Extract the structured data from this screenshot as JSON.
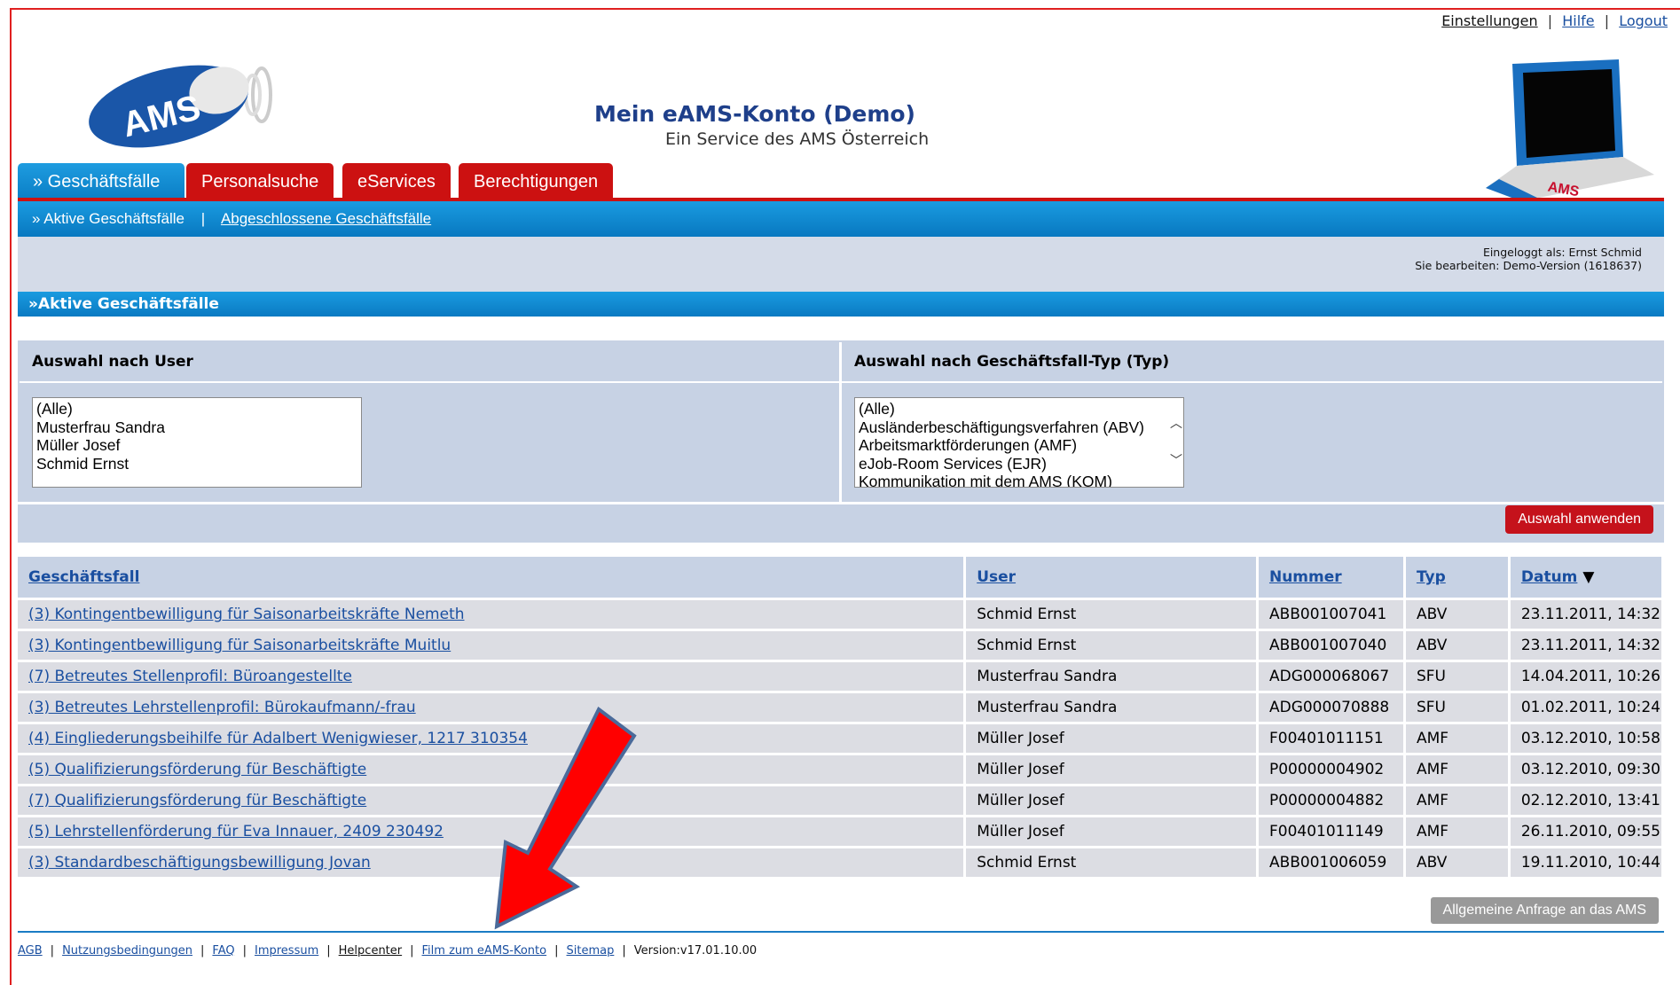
{
  "toplinks": {
    "settings": "Einstellungen",
    "help": "Hilfe",
    "logout": "Logout",
    "sep": "|"
  },
  "header": {
    "logo_text": "AMS",
    "title": "Mein eAMS-Konto (Demo)",
    "subtitle": "Ein Service des AMS Österreich",
    "laptop_label": "AMS"
  },
  "tabs": [
    {
      "label": "» Geschäftsfälle"
    },
    {
      "label": "Personalsuche"
    },
    {
      "label": "eServices"
    },
    {
      "label": "Berechtigungen"
    }
  ],
  "subnav": {
    "active": "» Aktive Geschäftsfälle",
    "sep": "|",
    "closed": "Abgeschlossene Geschäftsfälle"
  },
  "info": {
    "logged_in": "Eingeloggt als: Ernst Schmid",
    "editing": "Sie bearbeiten: Demo-Version (1618637)"
  },
  "section_title": "»Aktive Geschäftsfälle",
  "filter": {
    "user": {
      "heading": "Auswahl nach User",
      "options": [
        "(Alle)",
        "Musterfrau Sandra",
        "Müller Josef",
        "Schmid Ernst"
      ]
    },
    "type": {
      "heading": "Auswahl nach Geschäftsfall-Typ (Typ)",
      "options": [
        "(Alle)",
        "Ausländerbeschäftigungsverfahren (ABV)",
        "Arbeitsmarktförderungen (AMF)",
        "eJob-Room Services (EJR)",
        "Kommunikation mit dem AMS (KOM)"
      ]
    },
    "apply_label": "Auswahl anwenden"
  },
  "table": {
    "headers": {
      "case": "Geschäftsfall",
      "user": "User",
      "number": "Nummer",
      "type": "Typ",
      "date": "Datum",
      "sort_icon": "▼"
    },
    "rows": [
      {
        "case": "(3) Kontingentbewilligung für Saisonarbeitskräfte Nemeth",
        "user": "Schmid Ernst",
        "number": "ABB001007041",
        "type": "ABV",
        "date": "23.11.2011, 14:32"
      },
      {
        "case": "(3) Kontingentbewilligung für Saisonarbeitskräfte Muitlu",
        "user": "Schmid Ernst",
        "number": "ABB001007040",
        "type": "ABV",
        "date": "23.11.2011, 14:32"
      },
      {
        "case": "(7) Betreutes Stellenprofil: Büroangestellte",
        "user": "Musterfrau Sandra",
        "number": "ADG000068067",
        "type": "SFU",
        "date": "14.04.2011, 10:26"
      },
      {
        "case": "(3) Betreutes Lehrstellenprofil: Bürokaufmann/-frau",
        "user": "Musterfrau Sandra",
        "number": "ADG000070888",
        "type": "SFU",
        "date": "01.02.2011, 10:24"
      },
      {
        "case": "(4) Eingliederungsbeihilfe für Adalbert Wenigwieser, 1217 310354",
        "user": "Müller Josef",
        "number": "F00401011151",
        "type": "AMF",
        "date": "03.12.2010, 10:58"
      },
      {
        "case": "(5) Qualifizierungsförderung für Beschäftigte",
        "user": "Müller Josef",
        "number": "P00000004902",
        "type": "AMF",
        "date": "03.12.2010, 09:30"
      },
      {
        "case": "(7) Qualifizierungsförderung für Beschäftigte",
        "user": "Müller Josef",
        "number": "P00000004882",
        "type": "AMF",
        "date": "02.12.2010, 13:41"
      },
      {
        "case": "(5) Lehrstellenförderung für Eva Innauer, 2409 230492",
        "user": "Müller Josef",
        "number": "F00401011149",
        "type": "AMF",
        "date": "26.11.2010, 09:55"
      },
      {
        "case": "(3) Standardbeschäftigungsbewilligung Jovan",
        "user": "Schmid Ernst",
        "number": "ABB001006059",
        "type": "ABV",
        "date": "19.11.2010, 10:44"
      }
    ]
  },
  "anfrage_label": "Allgemeine Anfrage an das AMS",
  "footer": {
    "links": [
      "AGB",
      "Nutzungsbedingungen",
      "FAQ",
      "Impressum",
      "Helpcenter",
      "Film zum eAMS-Konto",
      "Sitemap"
    ],
    "sep": "|",
    "version": "Version:v17.01.10.00"
  },
  "colors": {
    "brand_red": "#cc1111",
    "brand_blue": "#0b7fc6",
    "panel": "#c7d2e4",
    "arrow": "#ff0000"
  }
}
